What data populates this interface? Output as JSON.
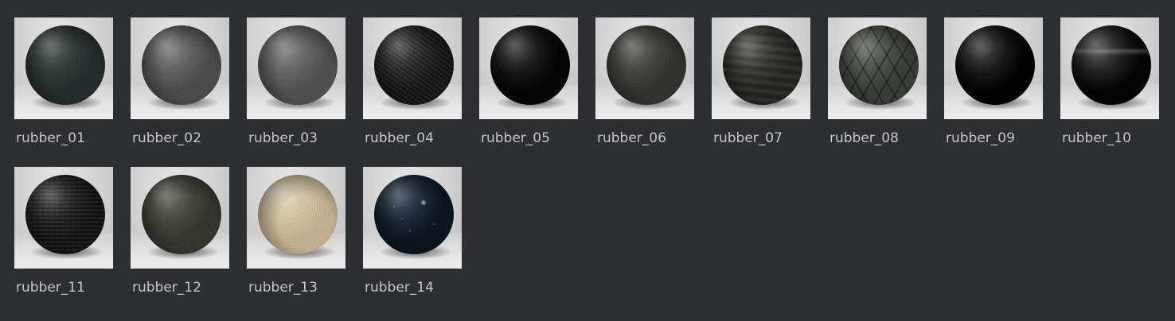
{
  "materials": [
    {
      "label": "rubber_01",
      "base": "#1f2a28",
      "highlight": "#3d4d48",
      "pattern": "grain"
    },
    {
      "label": "rubber_02",
      "base": "#4a4a4a",
      "highlight": "#7a7a7a",
      "pattern": "grain"
    },
    {
      "label": "rubber_03",
      "base": "#505050",
      "highlight": "#7c7c7c",
      "pattern": "smooth"
    },
    {
      "label": "rubber_04",
      "base": "#0f0f0f",
      "highlight": "#3a3a3a",
      "pattern": "crinkle"
    },
    {
      "label": "rubber_05",
      "base": "#050505",
      "highlight": "#2e2e2e",
      "pattern": "smooth"
    },
    {
      "label": "rubber_06",
      "base": "#2f2f2c",
      "highlight": "#5a5a55",
      "pattern": "grain"
    },
    {
      "label": "rubber_07",
      "base": "#262622",
      "highlight": "#4e4e48",
      "pattern": "stripes"
    },
    {
      "label": "rubber_08",
      "base": "#3a3d38",
      "highlight": "#626660",
      "pattern": "diamond"
    },
    {
      "label": "rubber_09",
      "base": "#030303",
      "highlight": "#333333",
      "pattern": "smooth"
    },
    {
      "label": "rubber_10",
      "base": "#050505",
      "highlight": "#444444",
      "pattern": "glossy"
    },
    {
      "label": "rubber_11",
      "base": "#161616",
      "highlight": "#3c3c3c",
      "pattern": "weave"
    },
    {
      "label": "rubber_12",
      "base": "#32342a",
      "highlight": "#5a5d4c",
      "pattern": "grain"
    },
    {
      "label": "rubber_13",
      "base": "#c7b592",
      "highlight": "#e6d8b8",
      "pattern": "grain"
    },
    {
      "label": "rubber_14",
      "base": "#0c1620",
      "highlight": "#2c3e52",
      "pattern": "speckle"
    }
  ]
}
